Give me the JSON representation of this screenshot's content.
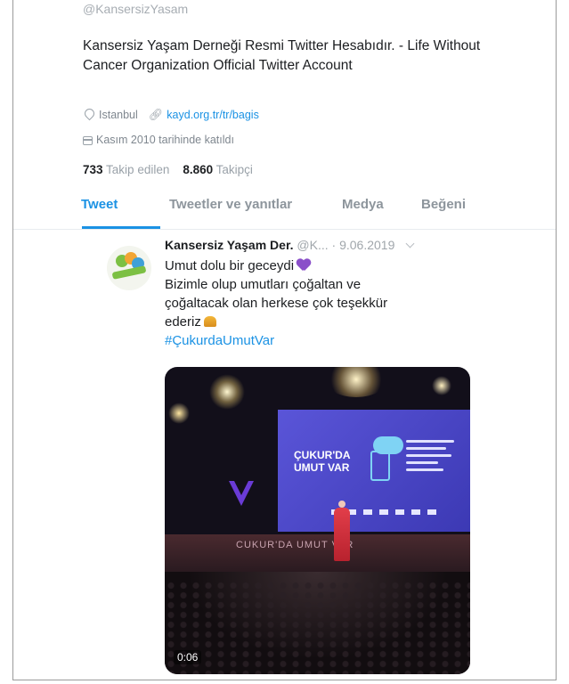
{
  "profile": {
    "handle": "@KansersizYasam",
    "bio": "Kansersiz Yaşam Derneği Resmi Twitter Hesabıdır. - Life Without Cancer Organization Official Twitter Account",
    "location": "Istanbul",
    "website": "kayd.org.tr/tr/bagis",
    "joined": "Kasım 2010 tarihinde katıldı",
    "following_count": "733",
    "following_label": "Takip edilen",
    "followers_count": "8.860",
    "followers_label": "Takipçi"
  },
  "tabs": [
    {
      "label": "Tweet",
      "active": true
    },
    {
      "label": "Tweetler ve yanıtlar",
      "active": false
    },
    {
      "label": "Medya",
      "active": false
    },
    {
      "label": "Beğeni",
      "active": false
    }
  ],
  "tweet": {
    "author_name": "Kansersiz Yaşam Der.",
    "author_handle": "@K...",
    "date": "9.06.2019",
    "line1": "Umut dolu bir geceydi",
    "line2": "Bizimle olup umutları çoğaltan ve",
    "line3": "çoğaltacak olan herkese çok teşekkür",
    "line4": "ederiz",
    "hashtag": "#ÇukurdaUmutVar",
    "media": {
      "screen_title_1": "ÇUKUR'DA",
      "screen_title_2": "UMUT VAR",
      "stage_text": "CUKUR'DA UMUT VAR",
      "duration": "0:06"
    }
  },
  "colors": {
    "accent": "#1b92e4",
    "heart": "#8a4fc9"
  }
}
